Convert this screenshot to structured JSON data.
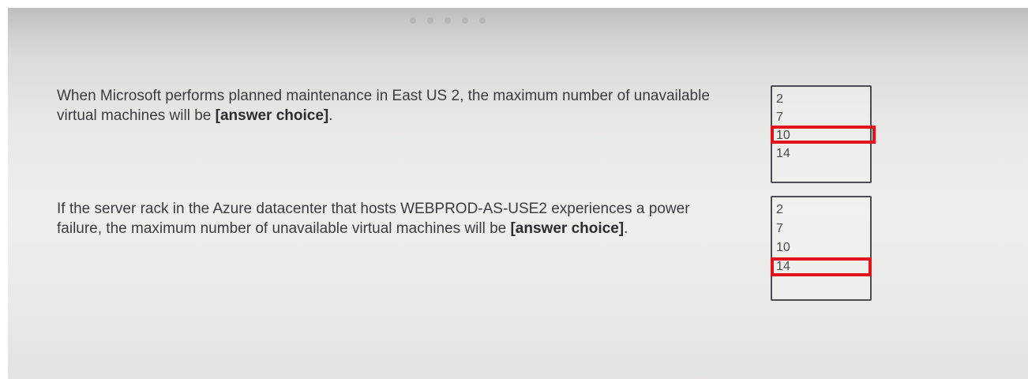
{
  "questions": [
    {
      "text_before": "When Microsoft performs planned maintenance in East US 2, the maximum number of unavailable virtual machines will be ",
      "placeholder": "[answer choice]",
      "text_after": ".",
      "options": [
        "2",
        "7",
        "10",
        "14"
      ],
      "selected": "10"
    },
    {
      "text_before": "If the server rack in the Azure datacenter that hosts WEBPROD-AS-USE2 experiences a power failure, the maximum number of unavailable virtual machines will be ",
      "placeholder": "[answer choice]",
      "text_after": ".",
      "options": [
        "2",
        "7",
        "10",
        "14"
      ],
      "selected": "14"
    }
  ],
  "pagination": {
    "dot_count": 5
  },
  "colors": {
    "selection_highlight": "#e0141a",
    "text": "#3a3c40",
    "box_border": "#4a4c52"
  }
}
